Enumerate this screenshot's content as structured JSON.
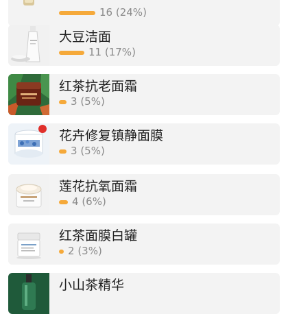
{
  "accent_color": "#f5a93a",
  "items": [
    {
      "name": "",
      "count": "16",
      "percent": "24%",
      "fraction": 0.24,
      "image": "product-bottle-icon"
    },
    {
      "name": "大豆洁面",
      "count": "11",
      "percent": "17%",
      "fraction": 0.17,
      "image": "cleanser-tube-icon"
    },
    {
      "name": "红茶抗老面霜",
      "count": "3",
      "percent": "5%",
      "fraction": 0.05,
      "image": "black-tea-cream-jar-icon"
    },
    {
      "name": "花卉修复镇静面膜",
      "count": "3",
      "percent": "5%",
      "fraction": 0.05,
      "image": "flower-mask-jar-icon"
    },
    {
      "name": "莲花抗氧面霜",
      "count": "4",
      "percent": "6%",
      "fraction": 0.06,
      "image": "lotus-cream-jar-icon"
    },
    {
      "name": "红茶面膜白罐",
      "count": "2",
      "percent": "3%",
      "fraction": 0.03,
      "image": "white-mask-jar-icon"
    },
    {
      "name": "小山茶精华",
      "count": "",
      "percent": "",
      "fraction": 0,
      "image": "serum-bottle-icon"
    }
  ]
}
